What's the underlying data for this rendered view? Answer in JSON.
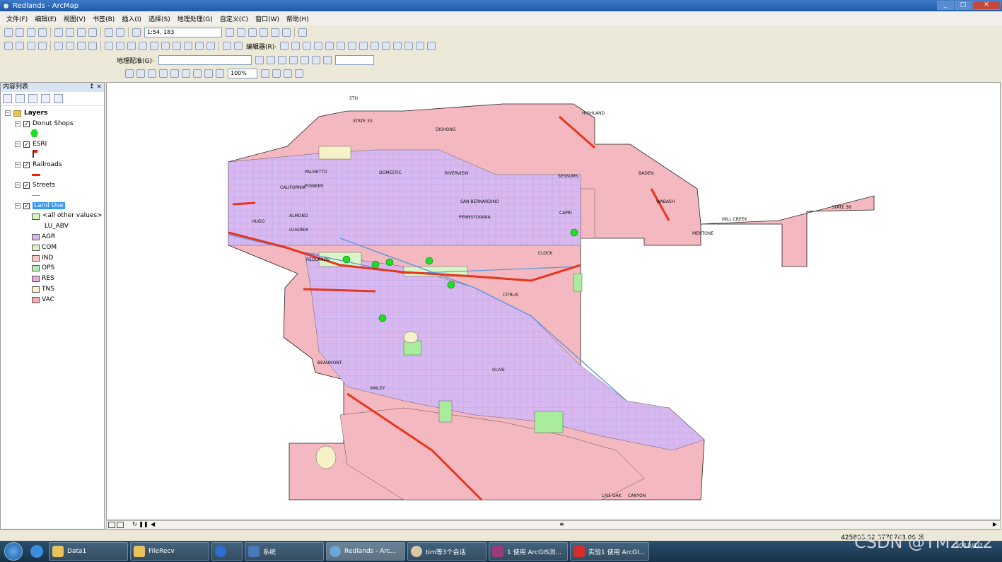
{
  "window": {
    "title": "Redlands - ArcMap"
  },
  "menu": [
    "文件(F)",
    "编辑(E)",
    "视图(V)",
    "书签(B)",
    "插入(I)",
    "选择(S)",
    "地理处理(G)",
    "自定义(C)",
    "窗口(W)",
    "帮助(H)"
  ],
  "toolbar": {
    "scale": "1:54, 183",
    "editor_label": "编辑器(R)·",
    "georef_label": "地理配准(G)·",
    "zoom_percent": "100%"
  },
  "toc": {
    "title": "内容列表",
    "pin": " ฿ ×",
    "root": "Layers",
    "layers": [
      {
        "name": "Donut Shops",
        "symbol_color": "#22dd22"
      },
      {
        "name": "ESRI",
        "symbol_color": "#ee1111"
      },
      {
        "name": "Railroads",
        "symbol_color": "#ee2200"
      },
      {
        "name": "Streets",
        "symbol_color": "#5aa0e6"
      },
      {
        "name": "Land Use",
        "selected": true
      }
    ],
    "land_use_field": "LU_ABV",
    "land_use_other": "<all other values>",
    "land_use_classes": [
      {
        "label": "AGR",
        "color": "#d9b8f0"
      },
      {
        "label": "COM",
        "color": "#d7f5c0"
      },
      {
        "label": "IND",
        "color": "#f5c7c2"
      },
      {
        "label": "OPS",
        "color": "#b6ecb4"
      },
      {
        "label": "RES",
        "color": "#e6a8d8"
      },
      {
        "label": "TNS",
        "color": "#f7f1c8"
      },
      {
        "label": "VAC",
        "color": "#f2aeb0"
      }
    ]
  },
  "map": {
    "colors": {
      "vacant": "#f4b8c0",
      "residential": "#d9b8f0",
      "commercial": "#d8f5c5",
      "ops": "#a9ec9e",
      "streets": "#5b94e0",
      "rail": "#e8341c",
      "donut": "#22dd22",
      "tns": "#f7f1c8"
    },
    "street_labels": [
      "5TH",
      "STATE 30",
      "DISHONG",
      "PALMETTO",
      "DOMESTIC",
      "RIVERVIEW",
      "BADEN",
      "PIONEER",
      "CALIFORNIA",
      "SESSUMS",
      "ALMOND",
      "HUGO",
      "LUGONIA",
      "REDLANDS",
      "CAPRI",
      "MILL CREEK",
      "STATE 38",
      "MENTONE",
      "WABASH",
      "CLOCK",
      "SAN BERNARDINO",
      "BEAUMONT",
      "SMILEY",
      "LIVE OAK",
      "CANYON",
      "PENNSYLVANIA",
      "CITRUS",
      "OLIVE",
      "HIGHLAND"
    ]
  },
  "status": {
    "coordinates": "425805.02  3770743.06 米"
  },
  "taskbar": {
    "items": [
      {
        "label": "Data1",
        "icon": "folder-icon",
        "color": "#e8c25a"
      },
      {
        "label": "FileRecv",
        "icon": "folder-icon",
        "color": "#e8c25a"
      },
      {
        "label": "",
        "icon": "sogou-icon",
        "color": "#2d6fcf"
      },
      {
        "label": "系统",
        "icon": "system-icon",
        "color": "#4a78b8"
      },
      {
        "label": "Redlands - Arc...",
        "icon": "arcmap-icon",
        "color": "#6aa6d8",
        "active": true
      },
      {
        "label": "tim等3个会话",
        "icon": "tim-icon",
        "color": "#d8c8a8"
      },
      {
        "label": "1 使用 ArcGIS浏...",
        "icon": "winrar-icon",
        "color": "#9a3b7a"
      },
      {
        "label": "实验1 使用 ArcGI...",
        "icon": "wps-icon",
        "color": "#d32f2f"
      }
    ],
    "clock_date": "2013/1/1"
  },
  "watermark": "CSDN @TM2022"
}
